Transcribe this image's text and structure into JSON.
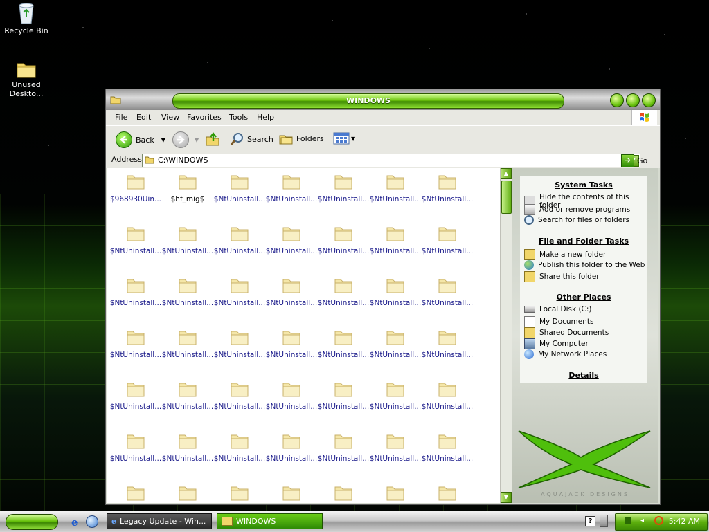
{
  "desktop": {
    "icons": [
      {
        "label": "Recycle Bin"
      },
      {
        "label": "Unused Deskto..."
      }
    ]
  },
  "window": {
    "title": "WINDOWS",
    "menu": [
      "File",
      "Edit",
      "View",
      "Favorites",
      "Tools",
      "Help"
    ],
    "toolbar": {
      "back": "Back",
      "search": "Search",
      "folders": "Folders"
    },
    "address": {
      "label": "Address",
      "value": "C:\\WINDOWS",
      "go": "Go"
    }
  },
  "folders": [
    "$968930Uin...",
    "$hf_mig$",
    "$NtUninstall...",
    "$NtUninstall...",
    "$NtUninstall...",
    "$NtUninstall...",
    "$NtUninstall...",
    "$NtUninstall...",
    "$NtUninstall...",
    "$NtUninstall...",
    "$NtUninstall...",
    "$NtUninstall...",
    "$NtUninstall...",
    "$NtUninstall...",
    "$NtUninstall...",
    "$NtUninstall...",
    "$NtUninstall...",
    "$NtUninstall...",
    "$NtUninstall...",
    "$NtUninstall...",
    "$NtUninstall...",
    "$NtUninstall...",
    "$NtUninstall...",
    "$NtUninstall...",
    "$NtUninstall...",
    "$NtUninstall...",
    "$NtUninstall...",
    "$NtUninstall...",
    "$NtUninstall...",
    "$NtUninstall...",
    "$NtUninstall...",
    "$NtUninstall...",
    "$NtUninstall...",
    "$NtUninstall...",
    "$NtUninstall...",
    "$NtUninstall...",
    "$NtUninstall...",
    "$NtUninstall...",
    "$NtUninstall...",
    "$NtUninstall...",
    "$NtUninstall...",
    "$NtUninstall...",
    "",
    "",
    "",
    "",
    "",
    "",
    ""
  ],
  "taskpane": {
    "system_tasks": {
      "title": "System Tasks",
      "items": [
        "Hide the contents of this folder",
        "Add or remove programs",
        "Search for files or folders"
      ]
    },
    "file_folder_tasks": {
      "title": "File and Folder Tasks",
      "items": [
        "Make a new folder",
        "Publish this folder to the Web",
        "Share this folder"
      ]
    },
    "other_places": {
      "title": "Other Places",
      "items": [
        "Local Disk (C:)",
        "My Documents",
        "Shared Documents",
        "My Computer",
        "My Network Places"
      ]
    },
    "details": {
      "title": "Details"
    },
    "logo_text": "AQUAJACK DESIGNS"
  },
  "taskbar": {
    "tasks": [
      {
        "label": "Legacy Update - Win..."
      },
      {
        "label": "WINDOWS"
      }
    ],
    "clock": "5:42 AM"
  },
  "colors": {
    "accent_green": "#6cc40c",
    "link_blue": "#1a1a8a"
  }
}
